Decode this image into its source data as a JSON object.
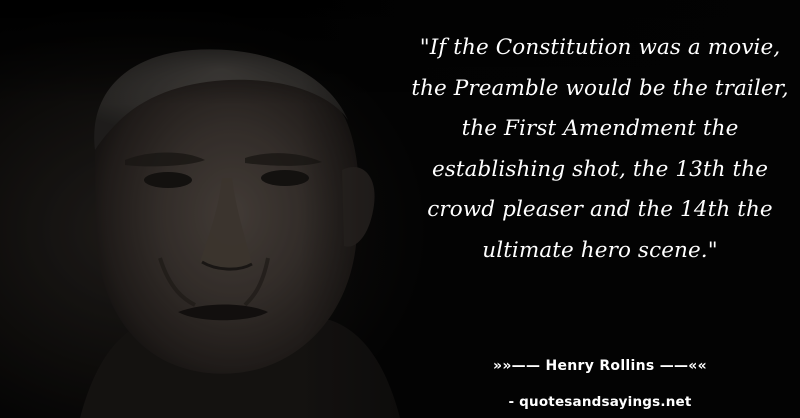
{
  "quote": {
    "text": "\"If the Constitution was a movie, the Preamble would be the trailer, the First Amendment the establishing shot, the 13th the crowd pleaser and the 14th the ultimate hero scene.\""
  },
  "author": {
    "line": "»»—— Henry Rollins ——««"
  },
  "source": {
    "line": "- quotesandsayings.net"
  },
  "colors": {
    "background": "#040404",
    "text": "#ffffff"
  }
}
